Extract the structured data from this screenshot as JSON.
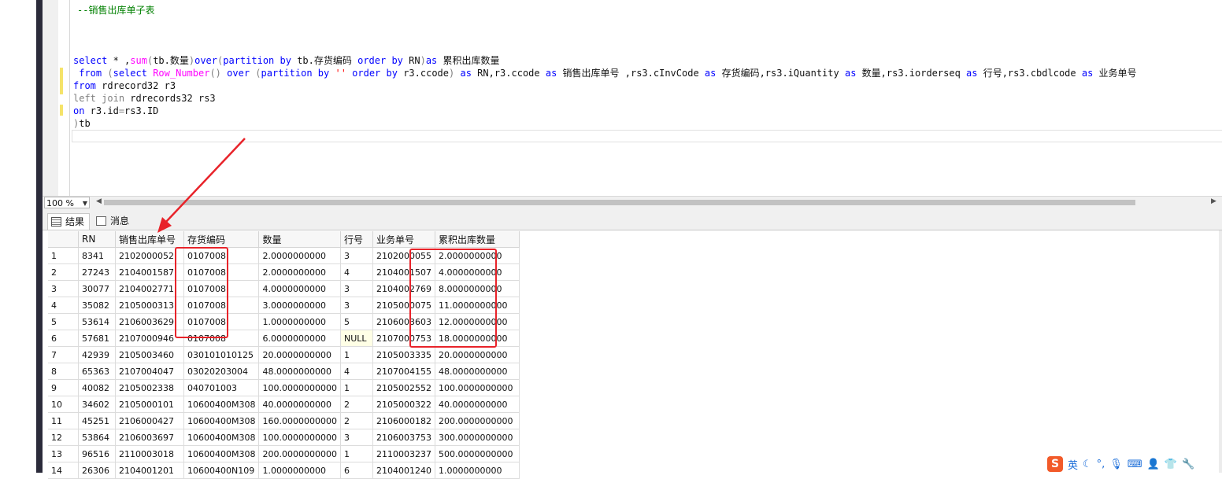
{
  "editor": {
    "comment": "--销售出库单子表",
    "lines": [
      "select * ,sum(tb.数量)over(partition by tb.存货编码 order by RN)as 累积出库数量",
      " from (select Row_Number() over (partition by '' order by r3.ccode) as RN,r3.ccode as 销售出库单号 ,rs3.cInvCode as 存货编码,rs3.iQuantity as 数量,rs3.iorderseq as 行号,rs3.cbdlcode as 业务单号",
      "from rdrecord32 r3",
      "left join rdrecords32 rs3",
      "on r3.id=rs3.ID",
      ")tb"
    ]
  },
  "zoom": {
    "value": "100 %"
  },
  "tabs": [
    {
      "label": "结果",
      "icon": "grid-icon"
    },
    {
      "label": "消息",
      "icon": "message-icon"
    }
  ],
  "grid": {
    "columns": [
      "",
      "RN",
      "销售出库单号",
      "存货编码",
      "数量",
      "行号",
      "业务单号",
      "累积出库数量"
    ],
    "rows": [
      [
        "1",
        "8341",
        "2102000052",
        "0107008",
        "2.0000000000",
        "3",
        "2102000055",
        "2.0000000000"
      ],
      [
        "2",
        "27243",
        "2104001587",
        "0107008",
        "2.0000000000",
        "4",
        "2104001507",
        "4.0000000000"
      ],
      [
        "3",
        "30077",
        "2104002771",
        "0107008",
        "4.0000000000",
        "3",
        "2104002769",
        "8.0000000000"
      ],
      [
        "4",
        "35082",
        "2105000313",
        "0107008",
        "3.0000000000",
        "3",
        "2105000075",
        "11.0000000000"
      ],
      [
        "5",
        "53614",
        "2106003629",
        "0107008",
        "1.0000000000",
        "5",
        "2106003603",
        "12.0000000000"
      ],
      [
        "6",
        "57681",
        "2107000946",
        "0107008",
        "6.0000000000",
        "NULL",
        "2107000753",
        "18.0000000000"
      ],
      [
        "7",
        "42939",
        "2105003460",
        "030101010125",
        "20.0000000000",
        "1",
        "2105003335",
        "20.0000000000"
      ],
      [
        "8",
        "65363",
        "2107004047",
        "03020203004",
        "48.0000000000",
        "4",
        "2107004155",
        "48.0000000000"
      ],
      [
        "9",
        "40082",
        "2105002338",
        "040701003",
        "100.0000000000",
        "1",
        "2105002552",
        "100.0000000000"
      ],
      [
        "10",
        "34602",
        "2105000101",
        "10600400M308",
        "40.0000000000",
        "2",
        "2105000322",
        "40.0000000000"
      ],
      [
        "11",
        "45251",
        "2106000427",
        "10600400M308",
        "160.0000000000",
        "2",
        "2106000182",
        "200.0000000000"
      ],
      [
        "12",
        "53864",
        "2106003697",
        "10600400M308",
        "100.0000000000",
        "3",
        "2106003753",
        "300.0000000000"
      ],
      [
        "13",
        "96516",
        "2110003018",
        "10600400M308",
        "200.0000000000",
        "1",
        "2110003237",
        "500.0000000000"
      ],
      [
        "14",
        "26306",
        "2104001201",
        "10600400N109",
        "1.0000000000",
        "6",
        "2104001240",
        "1.0000000000"
      ]
    ]
  },
  "ime": {
    "logo": "S",
    "mode": "英"
  },
  "colors": {
    "highlight": "#e8232a",
    "keyword": "#0000ff",
    "comment": "#008000",
    "function": "#ff00ff",
    "string": "#ff0000"
  }
}
